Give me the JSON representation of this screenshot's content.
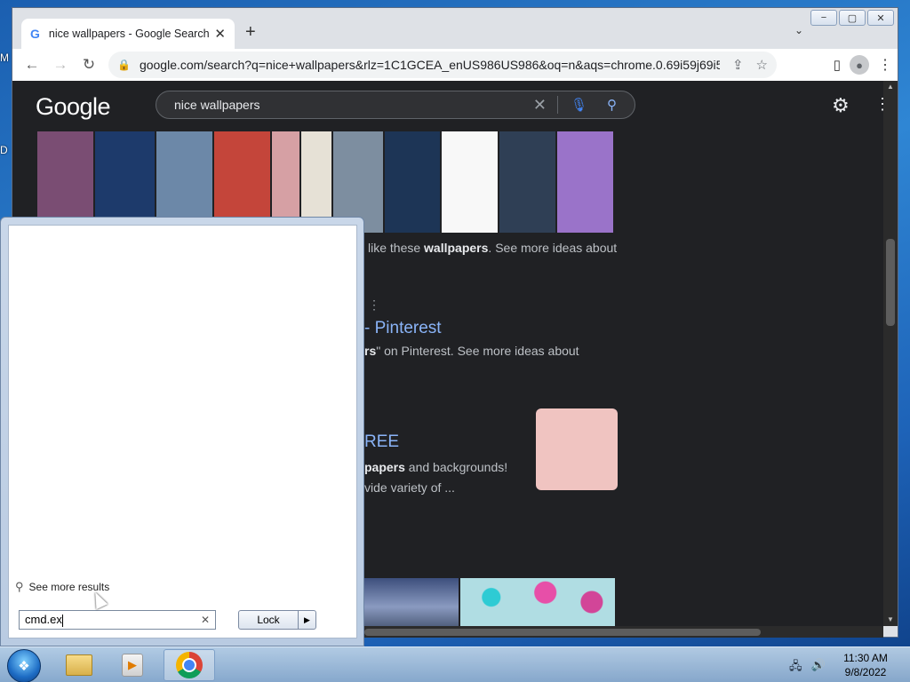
{
  "desktop": {
    "labels": [
      "M",
      "D"
    ]
  },
  "window_controls": [
    "−",
    "▢",
    "✕"
  ],
  "tab": {
    "favicon": "G",
    "title": "nice wallpapers - Google Search",
    "close": "✕"
  },
  "new_tab": "+",
  "tab_dropdown": "⌄",
  "toolbar": {
    "back": "←",
    "forward": "→",
    "reload": "↻"
  },
  "address": {
    "lock_icon": "lock-icon",
    "url": "google.com/search?q=nice+wallpapers&rlz=1C1GCEA_enUS986US986&oq=n&aqs=chrome.0.69i59j69i57j4..."
  },
  "google": {
    "logo": "Google",
    "query": "nice wallpapers",
    "results": {
      "snippet1_prefix": "like these ",
      "snippet1_bold": "wallpapers",
      "snippet1_suffix": ". See more ideas about",
      "title2": "- Pinterest",
      "snippet2_bold": "rs",
      "snippet2_suffix": "\" on Pinterest. See more ideas about",
      "title3": "REE",
      "snippet3_bold": "papers",
      "snippet3_suffix": " and backgrounds!",
      "snippet3_line2": "vide variety of ..."
    },
    "thumb_colors": [
      "#7a4d73",
      "#1d3a6b",
      "#6c88a8",
      "#c4453a",
      "#d6a0a4",
      "#e6e1d6",
      "#7d8ea0",
      "#1d3556",
      "#f8f8f8",
      "#2f3f55",
      "#9a73c9"
    ],
    "thumb_widths": [
      63,
      67,
      63,
      63,
      31,
      34,
      56,
      62,
      63,
      63,
      63
    ]
  },
  "start_menu": {
    "see_more": "See more results",
    "search_value": "cmd.ex",
    "power_button": "Lock"
  },
  "taskbar": {
    "time": "11:30 AM",
    "date": "9/8/2022"
  }
}
